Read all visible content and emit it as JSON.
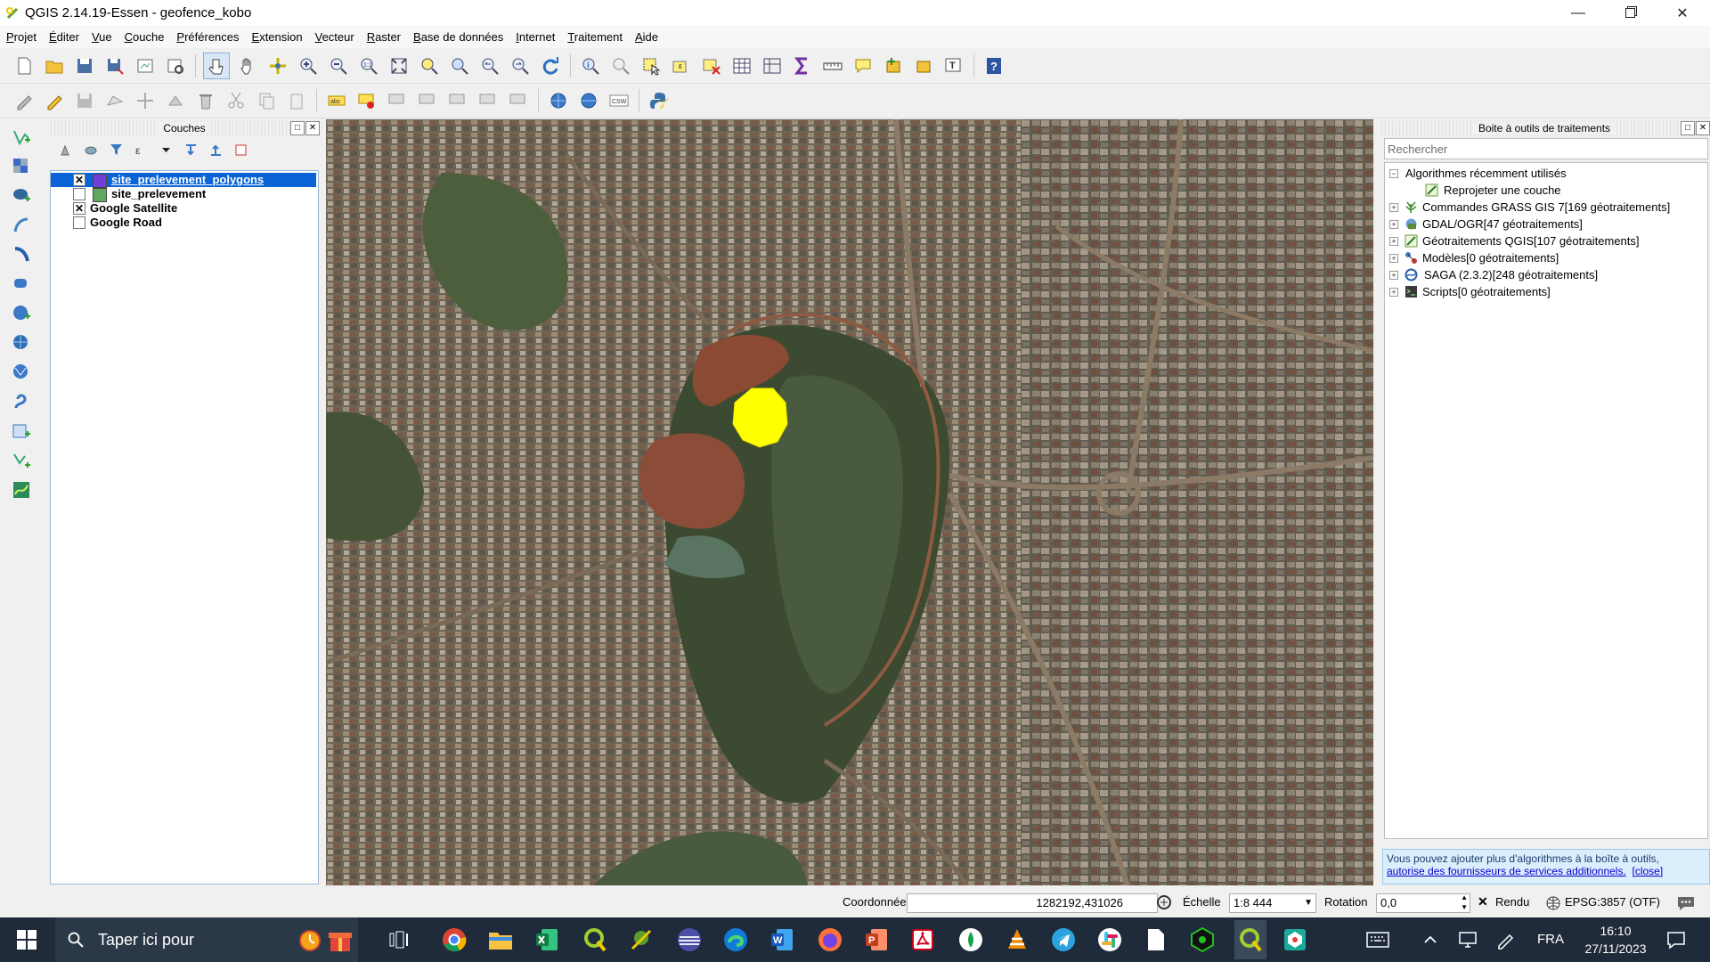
{
  "window": {
    "title": "QGIS 2.14.19-Essen - geofence_kobo"
  },
  "menu": [
    "Projet",
    "Éditer",
    "Vue",
    "Couche",
    "Préférences",
    "Extension",
    "Vecteur",
    "Raster",
    "Base de données",
    "Internet",
    "Traitement",
    "Aide"
  ],
  "layers_panel": {
    "title": "Couches",
    "layers": [
      {
        "name": "site_prelevement_polygons",
        "checked": true,
        "selected": true,
        "swatch": "#6f3fd8"
      },
      {
        "name": "site_prelevement",
        "checked": false,
        "selected": false,
        "swatch": "#5fa85f"
      },
      {
        "name": "Google Satellite",
        "checked": true,
        "selected": false
      },
      {
        "name": "Google Road",
        "checked": false,
        "selected": false
      }
    ]
  },
  "map": {
    "polygon_color": "#ffff00"
  },
  "toolbox": {
    "title": "Boite à outils de traitements",
    "search_placeholder": "Rechercher",
    "recent": {
      "label": "Algorithmes récemment utilisés",
      "items": [
        "Reprojeter une couche"
      ]
    },
    "providers": [
      "Commandes GRASS GIS 7[169 géotraitements]",
      "GDAL/OGR[47 géotraitements]",
      "Géotraitements QGIS[107 géotraitements]",
      "Modèles[0 géotraitements]",
      "SAGA (2.3.2)[248 géotraitements]",
      "Scripts[0 géotraitements]"
    ],
    "notice_text": "Vous pouvez ajouter plus d'algorithmes à la boîte à outils,",
    "notice_link": "autorise des fournisseurs de services additionnels.",
    "notice_close": "[close]"
  },
  "statusbar": {
    "coord_label": "Coordonnée",
    "coord_value": "1282192,431026",
    "scale_label": "Échelle",
    "scale_value": "1:8 444",
    "rotation_label": "Rotation",
    "rotation_value": "0,0",
    "render_label": "Rendu",
    "crs_label": "EPSG:3857 (OTF)"
  },
  "taskbar": {
    "search_text": "Taper ici pour",
    "lang": "FRA",
    "time": "16:10",
    "date": "27/11/2023"
  }
}
